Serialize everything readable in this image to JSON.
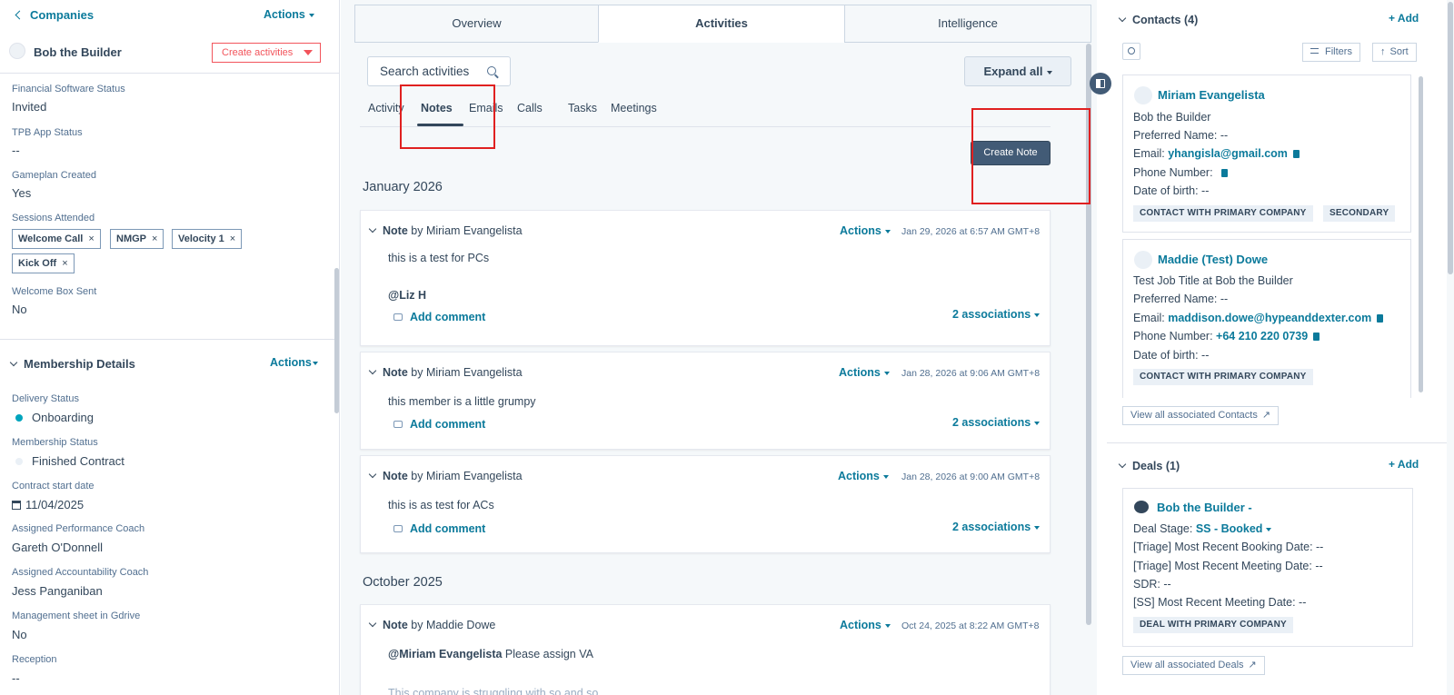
{
  "left": {
    "back_label": "Companies",
    "actions_label": "Actions",
    "company_name": "Bob the Builder",
    "create_activities_label": "Create activities",
    "fields": [
      {
        "label": "Financial Software Status",
        "value": "Invited"
      },
      {
        "label": "TPB App Status",
        "value": "--"
      },
      {
        "label": "Gameplan Created",
        "value": "Yes"
      }
    ],
    "sessions_label": "Sessions Attended",
    "sessions_tags": [
      "Welcome Call",
      "NMGP",
      "Velocity 1",
      "Kick Off"
    ],
    "welcome_box_label": "Welcome Box Sent",
    "welcome_box_value": "No",
    "membership_title": "Membership Details",
    "membership_actions": "Actions",
    "membership_fields": {
      "delivery_label": "Delivery Status",
      "delivery_value": "Onboarding",
      "status_label": "Membership Status",
      "status_value": "Finished Contract",
      "contract_label": "Contract start date",
      "contract_value": "11/04/2025",
      "perf_label": "Assigned Performance Coach",
      "perf_value": "Gareth O'Donnell",
      "acc_label": "Assigned Accountability Coach",
      "acc_value": "Jess Panganiban",
      "mgmt_label": "Management sheet in Gdrive",
      "mgmt_value": "No",
      "reception_label": "Reception",
      "reception_value": "--"
    }
  },
  "middle": {
    "tabs": [
      "Overview",
      "Activities",
      "Intelligence"
    ],
    "search_placeholder": "Search activities",
    "expand_all_label": "Expand all",
    "subtabs": [
      "Activity",
      "Notes",
      "Emails",
      "Calls",
      "Tasks",
      "Meetings"
    ],
    "create_note_label": "Create Note",
    "month1": "January 2026",
    "month2": "October 2025",
    "note_word": "Note",
    "notes": [
      {
        "by": "by Miriam Evangelista",
        "actions": "Actions",
        "date": "Jan 29, 2026 at 6:57 AM GMT+8",
        "body": "this is a test for PCs",
        "mention": "@Liz H",
        "comment": "Add comment",
        "assoc": "2 associations"
      },
      {
        "by": "by Miriam Evangelista",
        "actions": "Actions",
        "date": "Jan 28, 2026 at 9:06 AM GMT+8",
        "body": "this member is a little grumpy",
        "comment": "Add comment",
        "assoc": "2 associations"
      },
      {
        "by": "by Miriam Evangelista",
        "actions": "Actions",
        "date": "Jan 28, 2026 at 9:00 AM GMT+8",
        "body": "this is as test for ACs",
        "comment": "Add comment",
        "assoc": "2 associations"
      },
      {
        "by": "by Maddie Dowe",
        "actions": "Actions",
        "date": "Oct 24, 2025 at 8:22 AM GMT+8",
        "mention": "@Miriam Evangelista",
        "body": "Please assign VA",
        "body2": "This company is struggling with so and so"
      }
    ]
  },
  "right": {
    "contacts_title": "Contacts (4)",
    "add_label": "+ Add",
    "filters_label": "Filters",
    "sort_label": "Sort",
    "contacts": [
      {
        "name": "Miriam Evangelista",
        "line1": "Bob the Builder",
        "preferred": "Preferred Name: --",
        "email_label": "Email:",
        "email": "yhangisla@gmail.com",
        "phone_label": "Phone Number:",
        "phone": "",
        "dob": "Date of birth: --",
        "badges": [
          "CONTACT WITH PRIMARY COMPANY",
          "SECONDARY"
        ]
      },
      {
        "name": "Maddie (Test) Dowe",
        "line1": "Test Job Title at Bob the Builder",
        "preferred": "Preferred Name: --",
        "email_label": "Email:",
        "email": "maddison.dowe@hypeanddexter.com",
        "phone_label": "Phone Number:",
        "phone": "+64 210 220 0739",
        "dob": "Date of birth: --",
        "badges": [
          "CONTACT WITH PRIMARY COMPANY"
        ]
      }
    ],
    "view_contacts": "View all associated Contacts",
    "deals_title": "Deals (1)",
    "deal": {
      "name": "Bob the Builder -",
      "stage_label": "Deal Stage:",
      "stage_value": "SS - Booked",
      "line1": "[Triage] Most Recent Booking Date: --",
      "line2": "[Triage] Most Recent Meeting Date: --",
      "line3": "SDR: --",
      "line4": "[SS] Most Recent Meeting Date: --",
      "badge": "DEAL WITH PRIMARY COMPANY"
    },
    "view_deals": "View all associated Deals"
  }
}
